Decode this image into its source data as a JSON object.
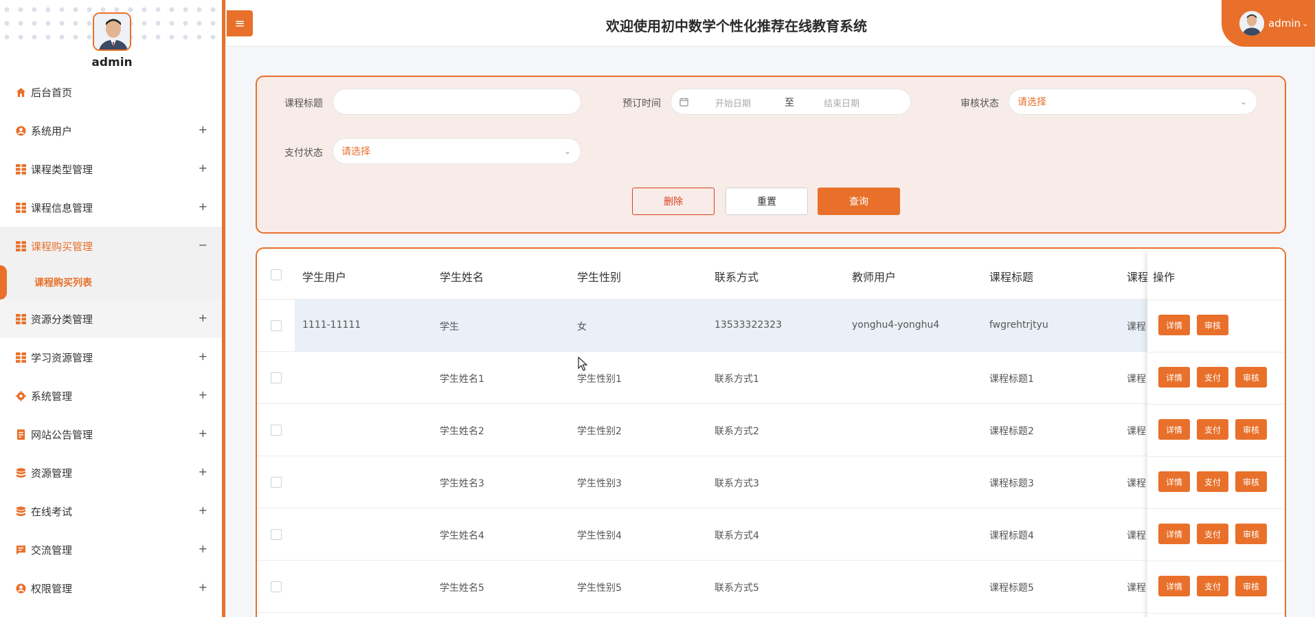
{
  "sidebar": {
    "username": "admin",
    "items": [
      {
        "label": "后台首页",
        "icon": "home-icon",
        "expandable": false
      },
      {
        "label": "系统用户",
        "icon": "user-circle-icon",
        "expandable": true
      },
      {
        "label": "课程类型管理",
        "icon": "grid-icon",
        "expandable": true
      },
      {
        "label": "课程信息管理",
        "icon": "grid-icon",
        "expandable": true
      },
      {
        "label": "课程购买管理",
        "icon": "grid-icon",
        "expandable": true,
        "expanded": true
      },
      {
        "label": "资源分类管理",
        "icon": "grid-icon",
        "expandable": true
      },
      {
        "label": "学习资源管理",
        "icon": "grid-icon",
        "expandable": true
      },
      {
        "label": "系统管理",
        "icon": "gear-icon",
        "expandable": true
      },
      {
        "label": "网站公告管理",
        "icon": "document-icon",
        "expandable": true
      },
      {
        "label": "资源管理",
        "icon": "database-icon",
        "expandable": true
      },
      {
        "label": "在线考试",
        "icon": "database-icon",
        "expandable": true
      },
      {
        "label": "交流管理",
        "icon": "chat-icon",
        "expandable": true
      },
      {
        "label": "权限管理",
        "icon": "user-circle-icon",
        "expandable": true
      }
    ],
    "sub_item": "课程购买列表",
    "plus": "+",
    "minus": "−"
  },
  "header": {
    "title": "欢迎使用初中数学个性化推荐在线教育系统",
    "user": "admin",
    "menu_icon": "menu-icon"
  },
  "search": {
    "course_title_label": "课程标题",
    "course_title_value": "",
    "booking_time_label": "预订时间",
    "start_date_placeholder": "开始日期",
    "to": "至",
    "end_date_placeholder": "结束日期",
    "review_status_label": "审核状态",
    "review_status_placeholder": "请选择",
    "pay_status_label": "支付状态",
    "pay_status_placeholder": "请选择",
    "delete_label": "删除",
    "reset_label": "重置",
    "query_label": "查询"
  },
  "table": {
    "columns": [
      "学生用户",
      "学生姓名",
      "学生性别",
      "联系方式",
      "教师用户",
      "课程标题",
      "课程"
    ],
    "op_header": "操作",
    "rows": [
      {
        "student_user": "1111-11111",
        "name": "学生",
        "gender": "女",
        "contact": "13533322323",
        "teacher": "yonghu4-yonghu4",
        "title": "fwgrehtrjtyu",
        "extra": "课程",
        "buttons": [
          "详情",
          "审核"
        ]
      },
      {
        "student_user": "",
        "name": "学生姓名1",
        "gender": "学生性别1",
        "contact": "联系方式1",
        "teacher": "",
        "title": "课程标题1",
        "extra": "课程",
        "buttons": [
          "详情",
          "支付",
          "审核"
        ]
      },
      {
        "student_user": "",
        "name": "学生姓名2",
        "gender": "学生性别2",
        "contact": "联系方式2",
        "teacher": "",
        "title": "课程标题2",
        "extra": "课程",
        "buttons": [
          "详情",
          "支付",
          "审核"
        ]
      },
      {
        "student_user": "",
        "name": "学生姓名3",
        "gender": "学生性别3",
        "contact": "联系方式3",
        "teacher": "",
        "title": "课程标题3",
        "extra": "课程",
        "buttons": [
          "详情",
          "支付",
          "审核"
        ]
      },
      {
        "student_user": "",
        "name": "学生姓名4",
        "gender": "学生性别4",
        "contact": "联系方式4",
        "teacher": "",
        "title": "课程标题4",
        "extra": "课程",
        "buttons": [
          "详情",
          "支付",
          "审核"
        ]
      },
      {
        "student_user": "",
        "name": "学生姓名5",
        "gender": "学生性别5",
        "contact": "联系方式5",
        "teacher": "",
        "title": "课程标题5",
        "extra": "课程",
        "buttons": [
          "详情",
          "支付",
          "审核"
        ]
      }
    ]
  },
  "colors": {
    "accent": "#e8702a",
    "highlight_row": "#e9f0f8",
    "panel_bg": "#f8ece8",
    "danger": "#d9401f"
  }
}
